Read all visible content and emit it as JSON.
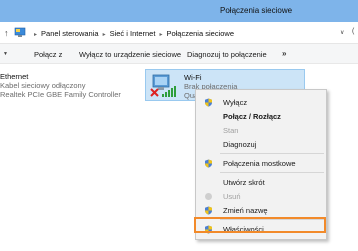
{
  "window": {
    "title": "Połączenia sieciowe"
  },
  "address": {
    "breadcrumbs": [
      "Panel sterowania",
      "Sieć i Internet",
      "Połączenia sieciowe"
    ]
  },
  "toolbar": {
    "items": [
      "Połącz z",
      "Wyłącz to urządzenie sieciowe",
      "Diagnozuj to połączenie"
    ],
    "more": "»"
  },
  "ethernet": {
    "name": "Ethernet",
    "status": "Kabel sieciowy odłączony",
    "device": "Realtek PCIe GBE Family Controller"
  },
  "wifi": {
    "name": "Wi-Fi",
    "status": "Brak połączenia",
    "extra": "Qual"
  },
  "context_menu": {
    "items": [
      {
        "label": "Wyłącz"
      },
      {
        "label": "Połącz / Rozłącz"
      },
      {
        "label": "Stan"
      },
      {
        "label": "Diagnozuj"
      },
      {
        "label": "Połączenia mostkowe"
      },
      {
        "label": "Utwórz skrót"
      },
      {
        "label": "Usuń"
      },
      {
        "label": "Zmień nazwę"
      },
      {
        "label": "Właściwości"
      }
    ]
  },
  "colors": {
    "titlebar": "#7eb4ea",
    "selection": "#cce4f7",
    "highlight_box": "#f28a2a"
  },
  "icons": [
    "up-arrow-icon",
    "control-panel-icon",
    "dropdown-icon",
    "wifi-adapter-icon",
    "disabled-x-icon",
    "signal-bars-icon",
    "uac-shield-icon"
  ]
}
